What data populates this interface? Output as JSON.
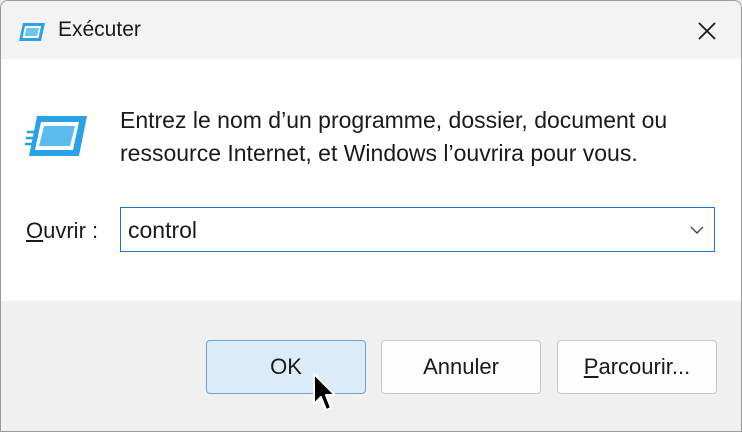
{
  "window": {
    "title": "Exécuter",
    "title_icon": "run-dialog-icon",
    "close_icon": "close-icon"
  },
  "content": {
    "icon": "run-dialog-icon",
    "description_line1": "Entrez le nom d’un programme, dossier, document ou",
    "description_line2": "ressource Internet, et Windows l’ouvrira pour vous.",
    "open_label_accel": "O",
    "open_label_rest": "uvrir :",
    "combo_value": "control",
    "combo_icon": "chevron-down-icon"
  },
  "buttons": {
    "ok_label": "OK",
    "cancel_label": "Annuler",
    "browse_label_accel": "P",
    "browse_label_rest": "arcourir..."
  },
  "colors": {
    "accent": "#1c76c6",
    "ok_button_bg": "#dcebf8",
    "icon_blue": "#2aa3e6"
  },
  "cursor_icon": "mouse-pointer-icon"
}
